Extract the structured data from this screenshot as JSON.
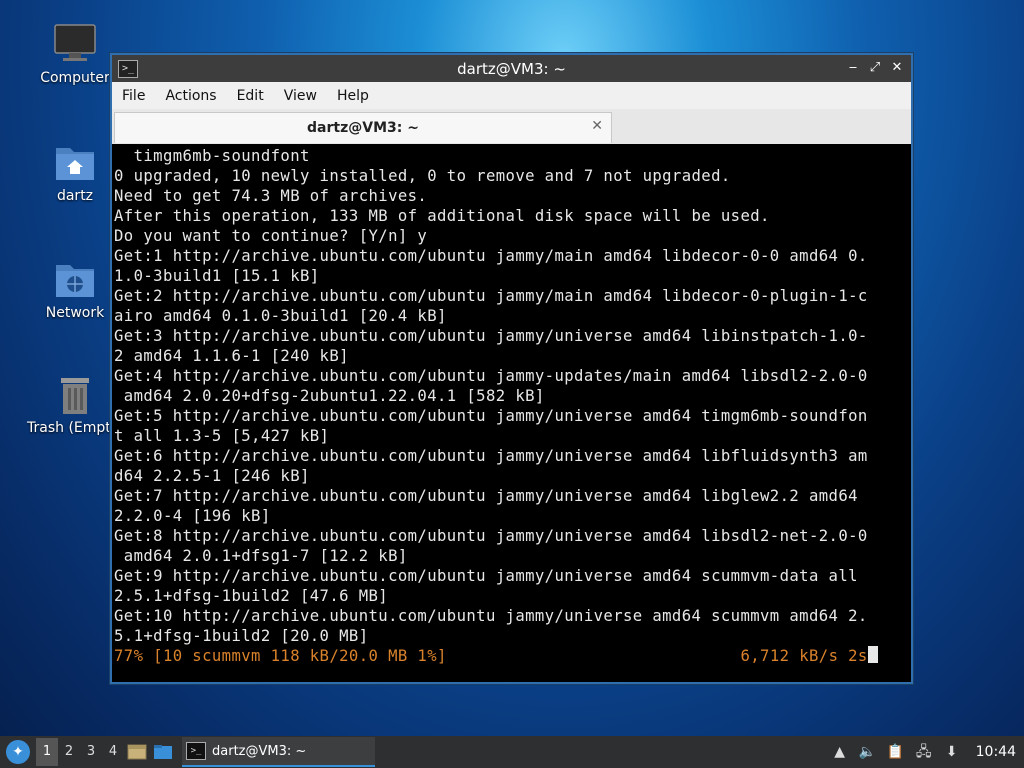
{
  "desktop": {
    "icons": [
      {
        "label": "Computer",
        "icon": "monitor-icon"
      },
      {
        "label": "dartz",
        "icon": "home-folder-icon"
      },
      {
        "label": "Network",
        "icon": "network-folder-icon"
      },
      {
        "label": "Trash (Empty)",
        "icon": "trash-icon"
      }
    ]
  },
  "window": {
    "title": "dartz@VM3: ~",
    "controls": {
      "minimize": "‒",
      "maximize": "⤢",
      "close": "✕"
    },
    "menu": [
      "File",
      "Actions",
      "Edit",
      "View",
      "Help"
    ],
    "tab": {
      "title": "dartz@VM3: ~",
      "close": "✕"
    }
  },
  "terminal": {
    "lines": [
      "  timgm6mb-soundfont",
      "0 upgraded, 10 newly installed, 0 to remove and 7 not upgraded.",
      "Need to get 74.3 MB of archives.",
      "After this operation, 133 MB of additional disk space will be used.",
      "Do you want to continue? [Y/n] y",
      "Get:1 http://archive.ubuntu.com/ubuntu jammy/main amd64 libdecor-0-0 amd64 0.",
      "1.0-3build1 [15.1 kB]",
      "Get:2 http://archive.ubuntu.com/ubuntu jammy/main amd64 libdecor-0-plugin-1-c",
      "airo amd64 0.1.0-3build1 [20.4 kB]",
      "Get:3 http://archive.ubuntu.com/ubuntu jammy/universe amd64 libinstpatch-1.0-",
      "2 amd64 1.1.6-1 [240 kB]",
      "Get:4 http://archive.ubuntu.com/ubuntu jammy-updates/main amd64 libsdl2-2.0-0",
      " amd64 2.0.20+dfsg-2ubuntu1.22.04.1 [582 kB]",
      "Get:5 http://archive.ubuntu.com/ubuntu jammy/universe amd64 timgm6mb-soundfon",
      "t all 1.3-5 [5,427 kB]",
      "Get:6 http://archive.ubuntu.com/ubuntu jammy/universe amd64 libfluidsynth3 am",
      "d64 2.2.5-1 [246 kB]",
      "Get:7 http://archive.ubuntu.com/ubuntu jammy/universe amd64 libglew2.2 amd64",
      "2.2.0-4 [196 kB]",
      "Get:8 http://archive.ubuntu.com/ubuntu jammy/universe amd64 libsdl2-net-2.0-0",
      " amd64 2.0.1+dfsg1-7 [12.2 kB]",
      "Get:9 http://archive.ubuntu.com/ubuntu jammy/universe amd64 scummvm-data all",
      "2.5.1+dfsg-1build2 [47.6 MB]",
      "Get:10 http://archive.ubuntu.com/ubuntu jammy/universe amd64 scummvm amd64 2.",
      "5.1+dfsg-1build2 [20.0 MB]"
    ],
    "status_left": "77% [10 scummvm 118 kB/20.0 MB 1%]",
    "status_right": "6,712 kB/s 2s",
    "status_color": "#d9822b"
  },
  "taskbar": {
    "start_icon": "lxqt-start-icon",
    "workspaces": [
      "1",
      "2",
      "3",
      "4"
    ],
    "active_workspace": "1",
    "task_label": "dartz@VM3: ~",
    "clock": "10:44",
    "tray_icons": [
      "removable-drive-icon",
      "volume-icon",
      "clipboard-icon",
      "network-icon",
      "update-notifier-icon"
    ]
  }
}
